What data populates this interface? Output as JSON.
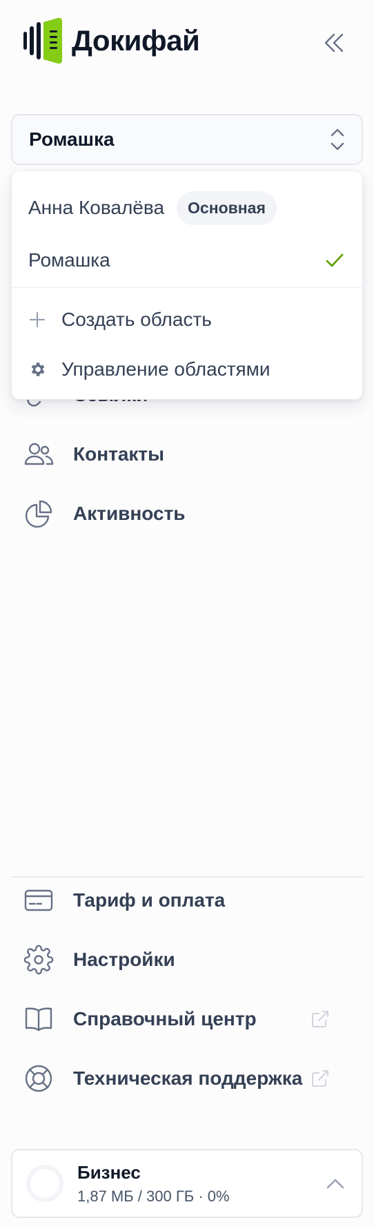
{
  "brand": {
    "name": "Докифай",
    "accent": "#84cc16"
  },
  "header": {
    "collapse_icon": "chevrons-left-icon"
  },
  "workspace": {
    "selected": "Ромашка",
    "icon": "chevron-up-down-icon"
  },
  "dropdown": {
    "items": [
      {
        "label": "Анна Ковалёва",
        "badge": "Основная"
      },
      {
        "label": "Ромашка",
        "checked": true,
        "check_color": "#65a30d"
      }
    ],
    "actions": [
      {
        "label": "Создать область",
        "icon": "plus-icon"
      },
      {
        "label": "Управление областями",
        "icon": "gear-icon"
      }
    ]
  },
  "nav": [
    {
      "label": "Ссылки",
      "icon": "link-icon"
    },
    {
      "label": "Контакты",
      "icon": "users-icon"
    },
    {
      "label": "Активность",
      "icon": "pie-chart-icon"
    }
  ],
  "footer_nav": [
    {
      "label": "Тариф и оплата",
      "icon": "credit-card-icon"
    },
    {
      "label": "Настройки",
      "icon": "settings-icon"
    },
    {
      "label": "Справочный центр",
      "icon": "book-icon",
      "external": true
    },
    {
      "label": "Техническая поддержка",
      "icon": "life-buoy-icon",
      "external": true
    }
  ],
  "plan": {
    "name": "Бизнес",
    "usage": "1,87 МБ / 300 ГБ · 0%",
    "progress_percent": 0
  }
}
